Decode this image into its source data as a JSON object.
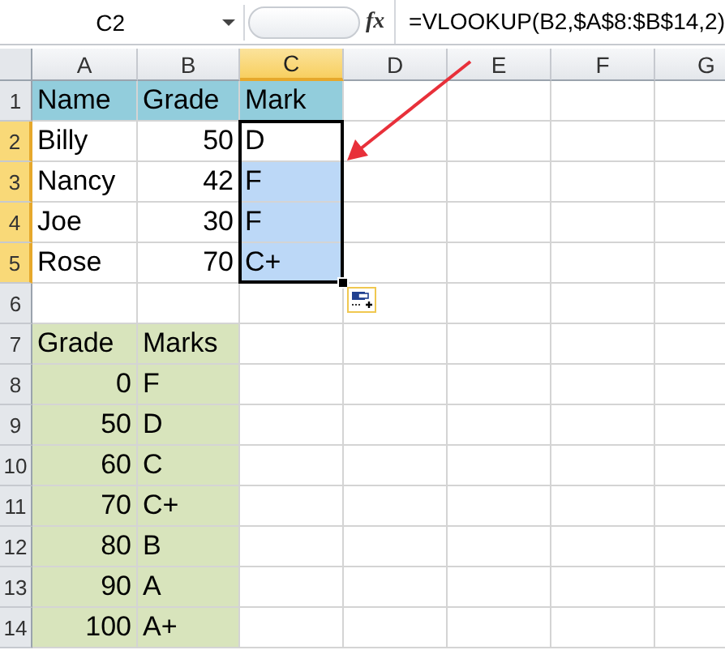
{
  "name_box": "C2",
  "fx_label": "fx",
  "formula": "=VLOOKUP(B2,$A$8:$B$14,2)",
  "columns": [
    {
      "label": "A",
      "selected": false
    },
    {
      "label": "B",
      "selected": false
    },
    {
      "label": "C",
      "selected": true
    },
    {
      "label": "D",
      "selected": false
    },
    {
      "label": "E",
      "selected": false
    },
    {
      "label": "F",
      "selected": false
    },
    {
      "label": "G",
      "selected": false
    }
  ],
  "row_numbers": [
    {
      "label": "1",
      "selected": false
    },
    {
      "label": "2",
      "selected": true
    },
    {
      "label": "3",
      "selected": true
    },
    {
      "label": "4",
      "selected": true
    },
    {
      "label": "5",
      "selected": true
    },
    {
      "label": "6",
      "selected": false
    },
    {
      "label": "7",
      "selected": false
    },
    {
      "label": "8",
      "selected": false
    },
    {
      "label": "9",
      "selected": false
    },
    {
      "label": "10",
      "selected": false
    },
    {
      "label": "11",
      "selected": false
    },
    {
      "label": "12",
      "selected": false
    },
    {
      "label": "13",
      "selected": false
    },
    {
      "label": "14",
      "selected": false
    }
  ],
  "students": {
    "header": [
      "Name",
      "Grade",
      "Mark"
    ],
    "rows": [
      {
        "name": "Billy",
        "grade": "50",
        "mark": "D",
        "selected": true,
        "active": true
      },
      {
        "name": "Nancy",
        "grade": "42",
        "mark": "F",
        "selected": true,
        "active": false
      },
      {
        "name": "Joe",
        "grade": "30",
        "mark": "F",
        "selected": true,
        "active": false
      },
      {
        "name": "Rose",
        "grade": "70",
        "mark": "C+",
        "selected": true,
        "active": false
      }
    ]
  },
  "grade_table": {
    "header": [
      "Grade",
      "Marks"
    ],
    "rows": [
      {
        "grade": "0",
        "mark": "F"
      },
      {
        "grade": "50",
        "mark": "D"
      },
      {
        "grade": "60",
        "mark": "C"
      },
      {
        "grade": "70",
        "mark": "C+"
      },
      {
        "grade": "80",
        "mark": "B"
      },
      {
        "grade": "90",
        "mark": "A"
      },
      {
        "grade": "100",
        "mark": "A+"
      }
    ]
  }
}
